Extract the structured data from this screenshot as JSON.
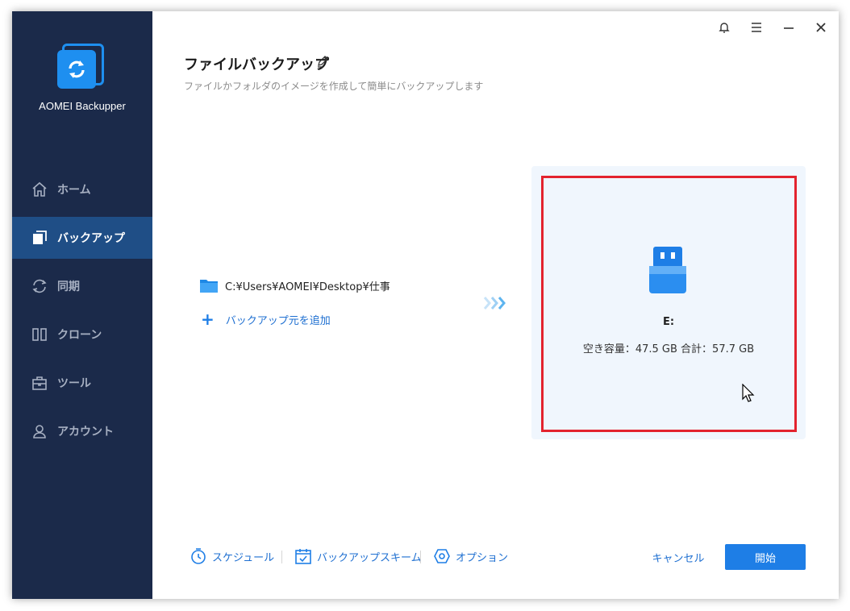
{
  "app": {
    "name": "AOMEI Backupper"
  },
  "titlebar": {
    "icons": [
      "bell-icon",
      "menu-icon",
      "minimize-icon",
      "close-icon"
    ]
  },
  "sidebar": {
    "items": [
      {
        "label": "ホーム",
        "icon": "home-icon",
        "active": false
      },
      {
        "label": "バックアップ",
        "icon": "backup-icon",
        "active": true
      },
      {
        "label": "同期",
        "icon": "sync-icon",
        "active": false
      },
      {
        "label": "クローン",
        "icon": "clone-icon",
        "active": false
      },
      {
        "label": "ツール",
        "icon": "tools-icon",
        "active": false
      },
      {
        "label": "アカウント",
        "icon": "account-icon",
        "active": false
      }
    ]
  },
  "main": {
    "title": "ファイルバックアップ",
    "subtitle": "ファイルかフォルダのイメージを作成して簡単にバックアップします",
    "source": {
      "path": "C:¥Users¥AOMEI¥Desktop¥仕事",
      "add_label": "バックアップ元を追加"
    },
    "destination": {
      "drive": "E:",
      "capacity": "空き容量：47.5 GB 合計：57.7 GB"
    }
  },
  "footer": {
    "schedule_label": "スケジュール",
    "scheme_label": "バックアップスキーム",
    "options_label": "オプション",
    "cancel_label": "キャンセル",
    "start_label": "開始"
  },
  "colors": {
    "sidebar_bg": "#1b2a4a",
    "sidebar_active": "#1f4e86",
    "accent": "#1e7ee6",
    "highlight_border": "#e3232e",
    "dest_card_bg": "#f0f6fd"
  }
}
